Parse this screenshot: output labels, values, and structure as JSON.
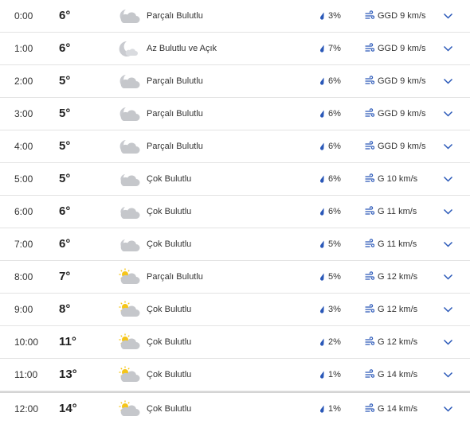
{
  "colors": {
    "accent": "#2a58b8",
    "cloud": "#c5c7cb",
    "moon": "#c9cbd0",
    "sun": "#f5c518",
    "divider": "#e3e3e3"
  },
  "rows": [
    {
      "time": "0:00",
      "temp": "6°",
      "icon": "partly-cloudy-night-icon",
      "condition": "Parçalı Bulutlu",
      "rain": "3%",
      "wind": "GGD 9 km/s"
    },
    {
      "time": "1:00",
      "temp": "6°",
      "icon": "mostly-clear-night-icon",
      "condition": "Az Bulutlu ve Açık",
      "rain": "7%",
      "wind": "GGD 9 km/s"
    },
    {
      "time": "2:00",
      "temp": "5°",
      "icon": "partly-cloudy-night-icon",
      "condition": "Parçalı Bulutlu",
      "rain": "6%",
      "wind": "GGD 9 km/s"
    },
    {
      "time": "3:00",
      "temp": "5°",
      "icon": "partly-cloudy-night-icon",
      "condition": "Parçalı Bulutlu",
      "rain": "6%",
      "wind": "GGD 9 km/s"
    },
    {
      "time": "4:00",
      "temp": "5°",
      "icon": "partly-cloudy-night-icon",
      "condition": "Parçalı Bulutlu",
      "rain": "6%",
      "wind": "GGD 9 km/s"
    },
    {
      "time": "5:00",
      "temp": "5°",
      "icon": "mostly-cloudy-night-icon",
      "condition": "Çok Bulutlu",
      "rain": "6%",
      "wind": "G 10 km/s"
    },
    {
      "time": "6:00",
      "temp": "6°",
      "icon": "mostly-cloudy-night-icon",
      "condition": "Çok Bulutlu",
      "rain": "6%",
      "wind": "G 11 km/s"
    },
    {
      "time": "7:00",
      "temp": "6°",
      "icon": "mostly-cloudy-night-icon",
      "condition": "Çok Bulutlu",
      "rain": "5%",
      "wind": "G 11 km/s"
    },
    {
      "time": "8:00",
      "temp": "7°",
      "icon": "partly-cloudy-day-icon",
      "condition": "Parçalı Bulutlu",
      "rain": "5%",
      "wind": "G 12 km/s"
    },
    {
      "time": "9:00",
      "temp": "8°",
      "icon": "mostly-cloudy-day-icon",
      "condition": "Çok Bulutlu",
      "rain": "3%",
      "wind": "G 12 km/s"
    },
    {
      "time": "10:00",
      "temp": "11°",
      "icon": "mostly-cloudy-day-icon",
      "condition": "Çok Bulutlu",
      "rain": "2%",
      "wind": "G 12 km/s"
    },
    {
      "time": "11:00",
      "temp": "13°",
      "icon": "mostly-cloudy-day-icon",
      "condition": "Çok Bulutlu",
      "rain": "1%",
      "wind": "G 14 km/s"
    },
    {
      "time": "12:00",
      "temp": "14°",
      "icon": "mostly-cloudy-day-icon",
      "condition": "Çok Bulutlu",
      "rain": "1%",
      "wind": "G 14 km/s"
    }
  ]
}
